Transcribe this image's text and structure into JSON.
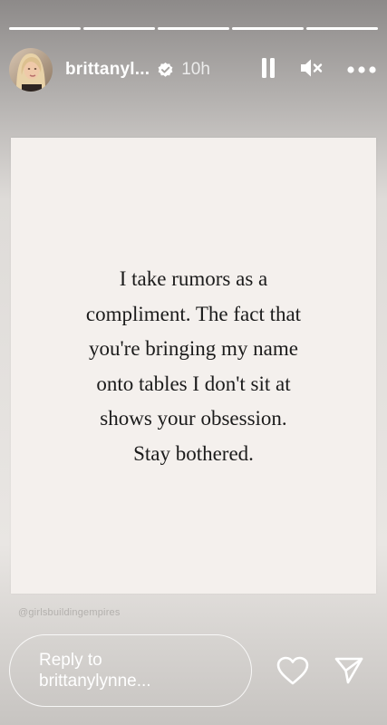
{
  "story": {
    "progress_segments": 5,
    "username": "brittanyl...",
    "time_ago": "10h"
  },
  "icons": {
    "verified": "verified-badge-icon",
    "pause": "pause-icon",
    "mute": "speaker-muted-icon",
    "more": "more-horizontal-icon",
    "like": "heart-icon",
    "share": "send-icon"
  },
  "post": {
    "quote": "I take rumors as a\ncompliment. The fact that\nyou're bringing my name\nonto tables I don't sit at\nshows your obsession.\nStay bothered.",
    "watermark": "@girlsbuildingempires"
  },
  "reply": {
    "placeholder": "Reply to\nbrittanylynne..."
  },
  "colors": {
    "card_background": "#f4f0ed",
    "text_dark": "#1b1b1b",
    "ui_white": "#ffffff"
  }
}
